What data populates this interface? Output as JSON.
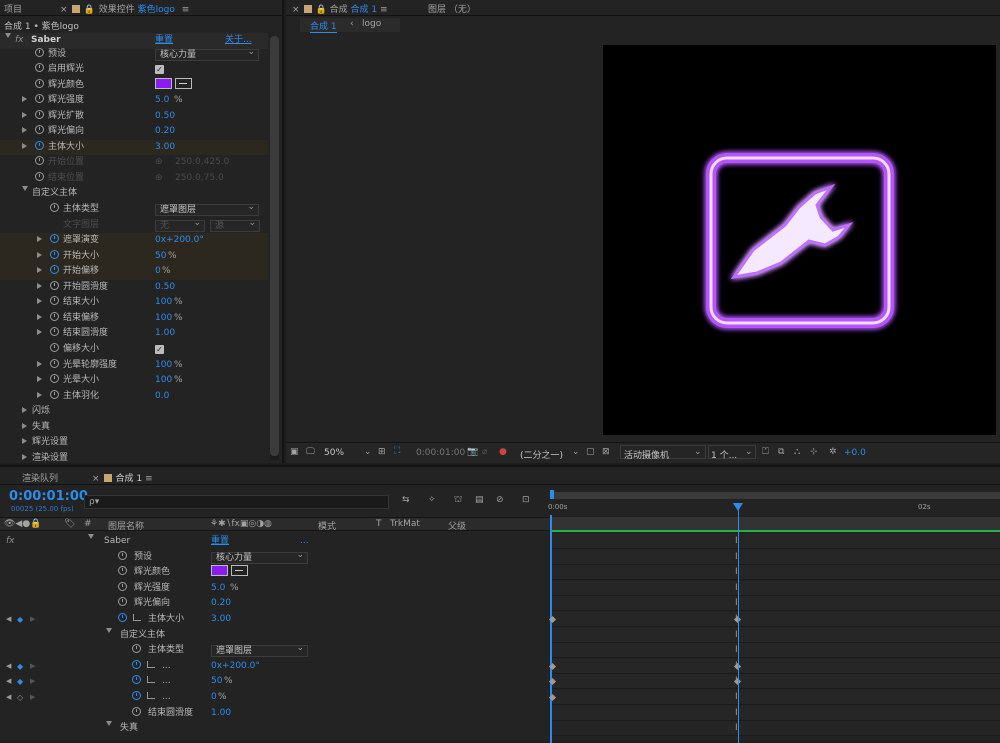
{
  "left_panel": {
    "tab_project": "项目",
    "tab_effects": "效果控件",
    "tab_effects_target": "紫色logo",
    "breadcrumb": "合成 1 • 紫色logo",
    "fx_name": "Saber",
    "reset": "重置",
    "about": "关于...",
    "props": [
      {
        "label": "预设",
        "value": "核心力量"
      },
      {
        "label": "启用辉光"
      },
      {
        "label": "辉光颜色"
      },
      {
        "label": "辉光强度",
        "value": "5.0",
        "unit": "%"
      },
      {
        "label": "辉光扩散",
        "value": "0.50"
      },
      {
        "label": "辉光偏向",
        "value": "0.20"
      },
      {
        "label": "主体大小",
        "value": "3.00"
      },
      {
        "label": "开始位置",
        "value": "250.0,425.0"
      },
      {
        "label": "结束位置",
        "value": "250.0,75.0"
      },
      {
        "label": "自定义主体"
      },
      {
        "label": "主体类型",
        "value": "遮罩图层"
      },
      {
        "label": "文字图层",
        "value": "无",
        "value2": "源"
      },
      {
        "label": "遮罩演变",
        "value": "0x+200.0°"
      },
      {
        "label": "开始大小",
        "value": "50",
        "unit": "%"
      },
      {
        "label": "开始偏移",
        "value": "0",
        "unit": "%"
      },
      {
        "label": "开始圆滑度",
        "value": "0.50"
      },
      {
        "label": "结束大小",
        "value": "100",
        "unit": "%"
      },
      {
        "label": "结束偏移",
        "value": "100",
        "unit": "%"
      },
      {
        "label": "结束圆滑度",
        "value": "1.00"
      },
      {
        "label": "偏移大小"
      },
      {
        "label": "光晕轮廓强度",
        "value": "100",
        "unit": "%"
      },
      {
        "label": "光晕大小",
        "value": "100",
        "unit": "%"
      },
      {
        "label": "主体羽化",
        "value": "0.0"
      },
      {
        "label": "闪烁"
      },
      {
        "label": "失真"
      },
      {
        "label": "辉光设置"
      },
      {
        "label": "渲染设置"
      }
    ]
  },
  "viewer": {
    "tab_comp": "合成",
    "tab_comp_name": "合成 1",
    "tab_layer": "图层 （无）",
    "nav_comp": "合成 1",
    "nav_layer": "logo",
    "zoom": "50%",
    "timecode": "0:00:01:00",
    "resolution": "(二分之一)",
    "camera": "活动摄像机",
    "views": "1 个...",
    "exposure": "+0.0"
  },
  "timeline": {
    "tab_render": "渲染队列",
    "tab_comp": "合成 1",
    "timecode": "0:00:01:00",
    "frames": "00025 (25.00 fps)",
    "search_placeholder": "ρ▾",
    "col_num": "#",
    "col_name": "图层名称",
    "col_mode": "模式",
    "col_t": "T",
    "col_trkmat": "TrkMat",
    "col_parent": "父级",
    "ruler": [
      "0:00s",
      "02s"
    ],
    "rows": [
      {
        "label": "Saber",
        "value": "重置",
        "extra": "..."
      },
      {
        "label": "预设",
        "value": "核心力量"
      },
      {
        "label": "辉光颜色"
      },
      {
        "label": "辉光强度",
        "value": "5.0",
        "unit": "%"
      },
      {
        "label": "辉光偏向",
        "value": "0.20"
      },
      {
        "label": "主体大小",
        "value": "3.00"
      },
      {
        "label": "自定义主体"
      },
      {
        "label": "主体类型",
        "value": "遮罩图层"
      },
      {
        "label": "...",
        "value": "0x+200.0°"
      },
      {
        "label": "...",
        "value": "50",
        "unit": "%"
      },
      {
        "label": "...",
        "value": "0",
        "unit": "%"
      },
      {
        "label": "结束圆滑度",
        "value": "1.00"
      },
      {
        "label": "失真"
      }
    ]
  }
}
